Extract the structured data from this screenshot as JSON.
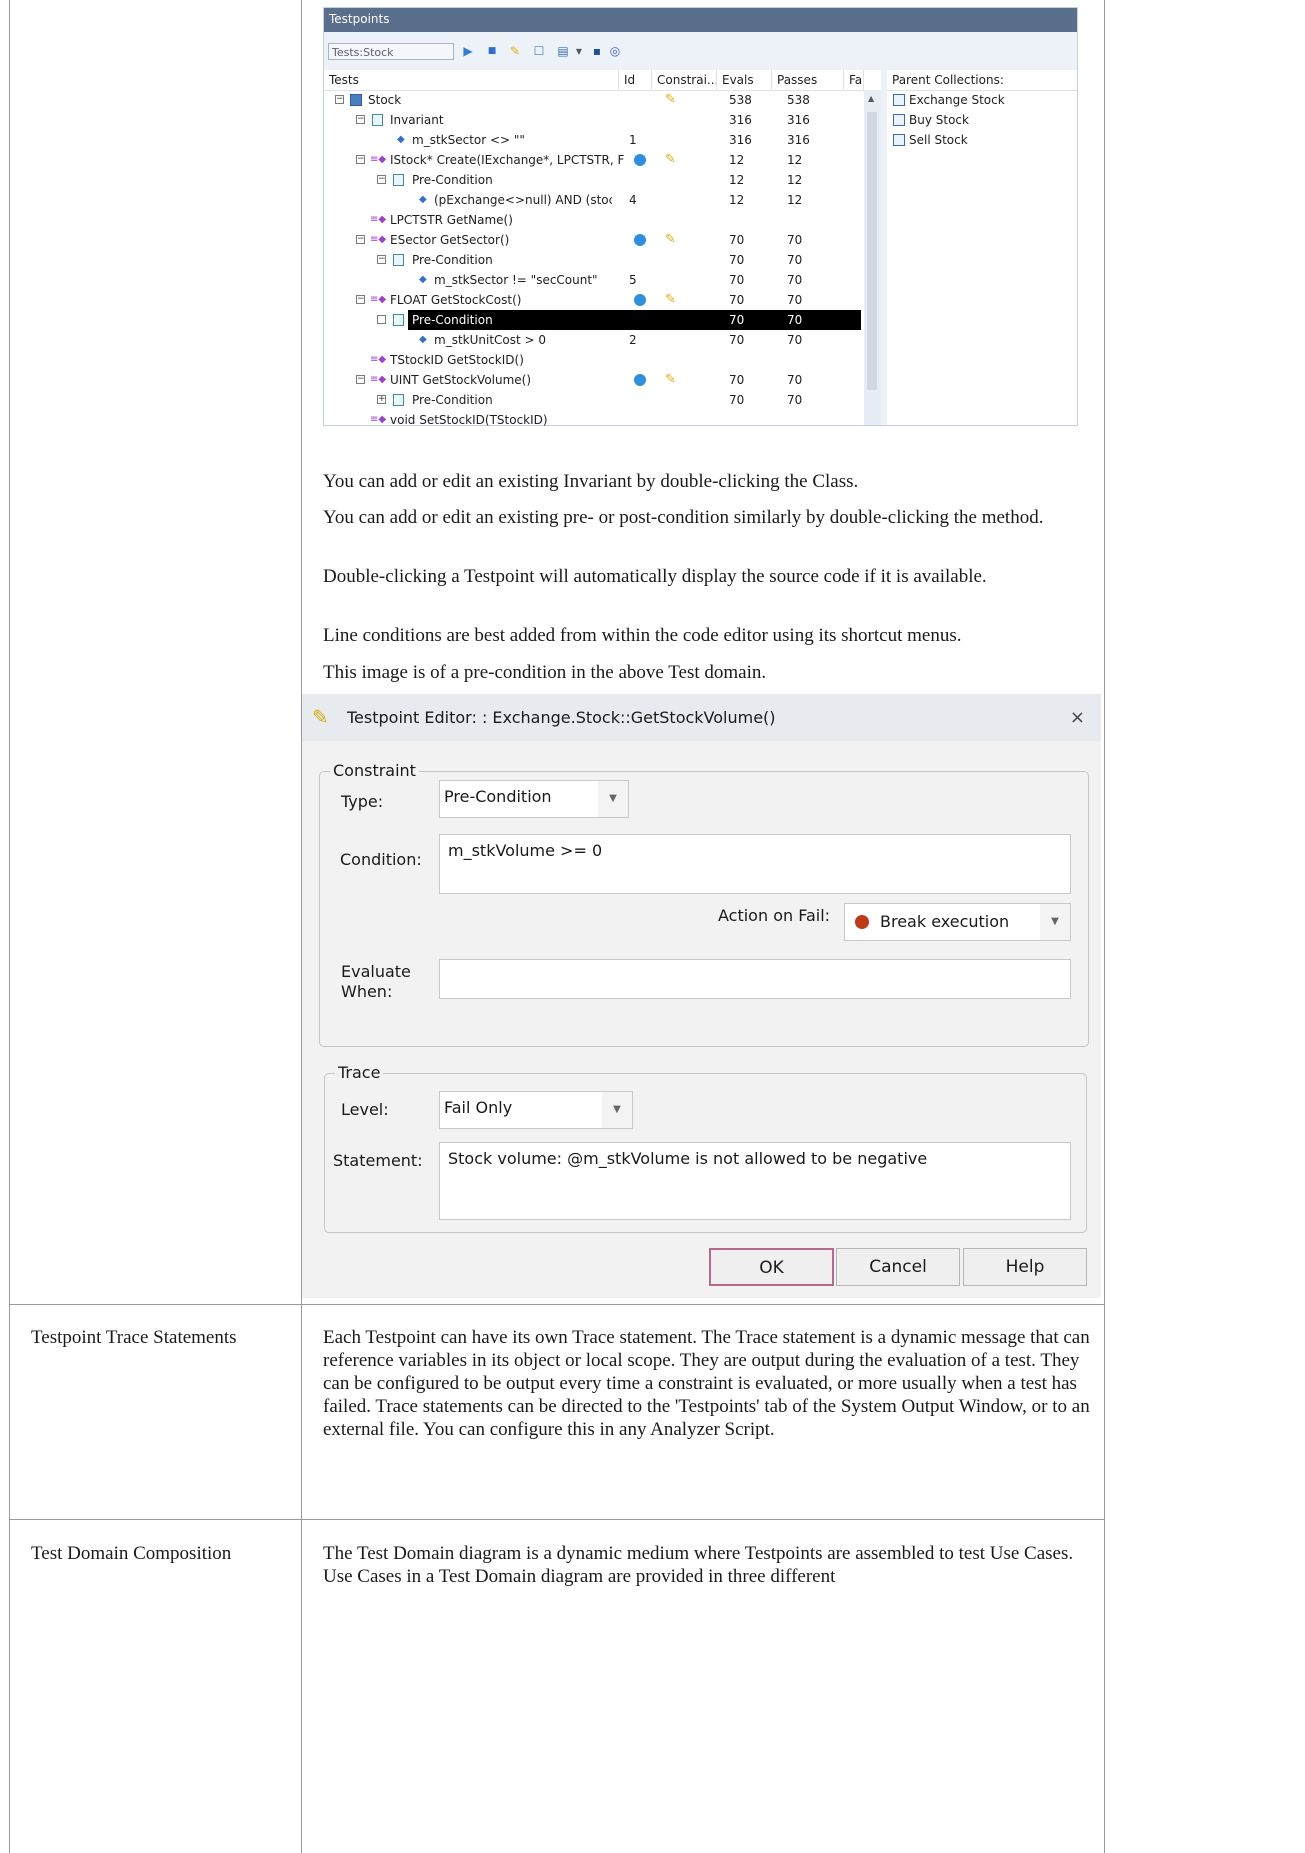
{
  "testpoints_panel": {
    "title": "Testpoints",
    "search_value": "Tests:Stock",
    "toolbar_icons": [
      "play-icon",
      "stop-icon",
      "pencil-icon",
      "checkbox-icon",
      "grid-icon",
      "dropdown-icon",
      "save-icon",
      "target-icon"
    ],
    "columns": [
      "Tests",
      "Id",
      "Constrai...",
      "Evals",
      "Passes",
      "Fa"
    ],
    "parent_header": "Parent Collections:",
    "rows": [
      {
        "name": "Stock",
        "id": "",
        "evals": "538",
        "passes": "538"
      },
      {
        "name": "Invariant",
        "id": "",
        "evals": "316",
        "passes": "316"
      },
      {
        "name": "m_stkSector <> \"\"",
        "id": "1",
        "evals": "316",
        "passes": "316"
      },
      {
        "name": "IStock* Create(IExchange*, LPCTSTR, F",
        "id": "",
        "evals": "12",
        "passes": "12"
      },
      {
        "name": "Pre-Condition",
        "id": "",
        "evals": "12",
        "passes": "12"
      },
      {
        "name": "(pExchange<>null) AND (stock",
        "id": "4",
        "evals": "12",
        "passes": "12"
      },
      {
        "name": "LPCTSTR GetName()",
        "id": "",
        "evals": "",
        "passes": ""
      },
      {
        "name": "ESector GetSector()",
        "id": "",
        "evals": "70",
        "passes": "70"
      },
      {
        "name": "Pre-Condition",
        "id": "",
        "evals": "70",
        "passes": "70"
      },
      {
        "name": "m_stkSector != \"secCount\"",
        "id": "5",
        "evals": "70",
        "passes": "70"
      },
      {
        "name": "FLOAT GetStockCost()",
        "id": "",
        "evals": "70",
        "passes": "70"
      },
      {
        "name": "Pre-Condition",
        "id": "",
        "evals": "70",
        "passes": "70"
      },
      {
        "name": "m_stkUnitCost > 0",
        "id": "2",
        "evals": "70",
        "passes": "70"
      },
      {
        "name": "TStockID GetStockID()",
        "id": "",
        "evals": "",
        "passes": ""
      },
      {
        "name": "UINT GetStockVolume()",
        "id": "",
        "evals": "70",
        "passes": "70"
      },
      {
        "name": "Pre-Condition",
        "id": "",
        "evals": "70",
        "passes": "70"
      },
      {
        "name": "void SetStockID(TStockID)",
        "id": "",
        "evals": "",
        "passes": ""
      }
    ],
    "parent_collections": [
      "Exchange Stock",
      "Buy Stock",
      "Sell Stock"
    ]
  },
  "paragraphs": [
    "You can add or edit an existing Invariant by double-clicking the Class.",
    "You can add or edit an existing pre- or post-condition similarly by double-clicking the method.",
    "Double-clicking a Testpoint will automatically display the source code if it is available.",
    "Line conditions are best added from within the code editor using its shortcut menus.",
    "This image is of a pre-condition in the above Test domain."
  ],
  "dialog": {
    "title": "Testpoint Editor: : Exchange.Stock::GetStockVolume()",
    "close": "×",
    "constraint": {
      "legend": "Constraint",
      "type_label": "Type:",
      "type_value": "Pre-Condition",
      "condition_label": "Condition:",
      "condition_value": "m_stkVolume >= 0",
      "action_label": "Action on Fail:",
      "action_value": "Break execution",
      "evaluate_label_1": "Evaluate",
      "evaluate_label_2": "When:",
      "evaluate_value": ""
    },
    "trace": {
      "legend": "Trace",
      "level_label": "Level:",
      "level_value": "Fail Only",
      "statement_label": "Statement:",
      "statement_value": "Stock volume: @m_stkVolume is not allowed to be negative"
    },
    "buttons": {
      "ok": "OK",
      "cancel": "Cancel",
      "help": "Help"
    }
  },
  "table_rows": [
    {
      "label": "Testpoint Trace Statements",
      "text": "Each Testpoint can have its own Trace statement. The Trace statement is a dynamic message that can reference variables in its object or local scope. They are output during the evaluation of a test. They can be configured to be output every time a constraint is evaluated, or more usually when a test has failed. Trace statements can be directed to the 'Testpoints' tab of the System Output Window, or to an external file. You can configure this in any Analyzer Script."
    },
    {
      "label": "Test Domain Composition",
      "text": "The Test Domain diagram is a dynamic medium where Testpoints are assembled to test Use Cases. Use Cases in a Test Domain diagram are provided in three different"
    }
  ]
}
